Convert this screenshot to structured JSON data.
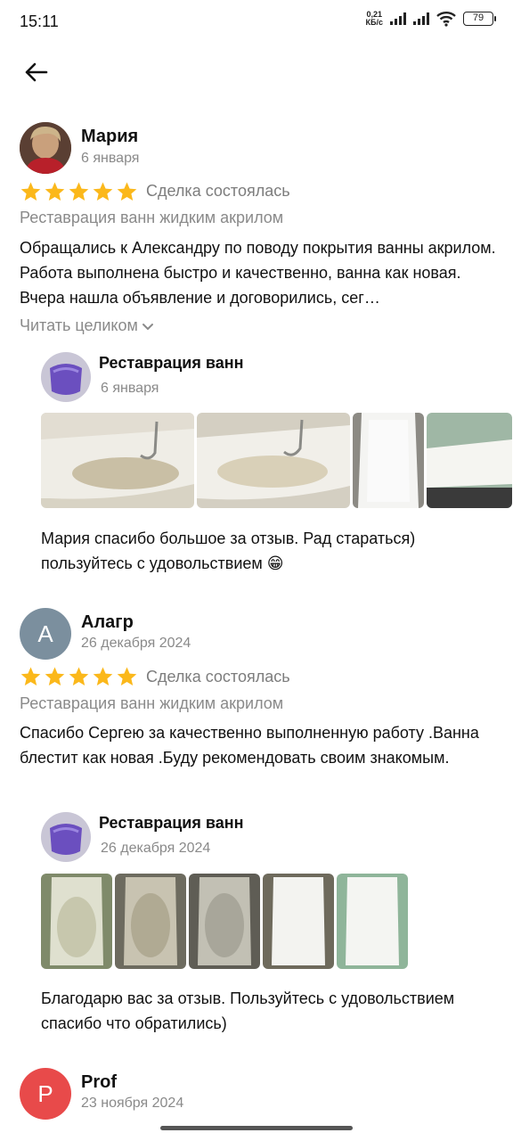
{
  "status_bar": {
    "time": "15:11",
    "net_speed_value": "0,21",
    "net_speed_unit": "КБ/с",
    "battery": "79"
  },
  "reviews": [
    {
      "author": "Мария",
      "date": "6 января",
      "rating": 5,
      "deal_status": "Сделка состоялась",
      "service": "Реставрация ванн жидким акрилом",
      "text": "Обращались к Александру по поводу покрытия ванны акрилом. Работа выполнена быстро и качественно, ванна как новая. Вчера нашла объявление и договорились, сег…",
      "read_more": "Читать целиком",
      "reply": {
        "author": "Реставрация ванн",
        "date": "6 января",
        "text": "Мария спасибо большое за отзыв. Рад стараться) пользуйтесь с удовольствием 😁"
      }
    },
    {
      "author": "Алагр",
      "avatar_letter": "А",
      "avatar_color": "#7b8f9e",
      "date": "26 декабря 2024",
      "rating": 5,
      "deal_status": "Сделка состоялась",
      "service": "Реставрация ванн жидким акрилом",
      "text": "Спасибо Сергею за качественно выполненную работу .Ванна блестит как новая .Буду рекомендовать своим знакомым.",
      "reply": {
        "author": "Реставрация ванн",
        "date": "26 декабря 2024",
        "text": "Благодарю вас за отзыв. Пользуйтесь с удовольствием спасибо что обратились)"
      }
    },
    {
      "author": "Prof",
      "avatar_letter": "P",
      "avatar_color": "#e84a4a",
      "date": "23 ноября 2024"
    }
  ],
  "colors": {
    "star": "#fbb81b",
    "muted_text": "#8a8a8a"
  }
}
